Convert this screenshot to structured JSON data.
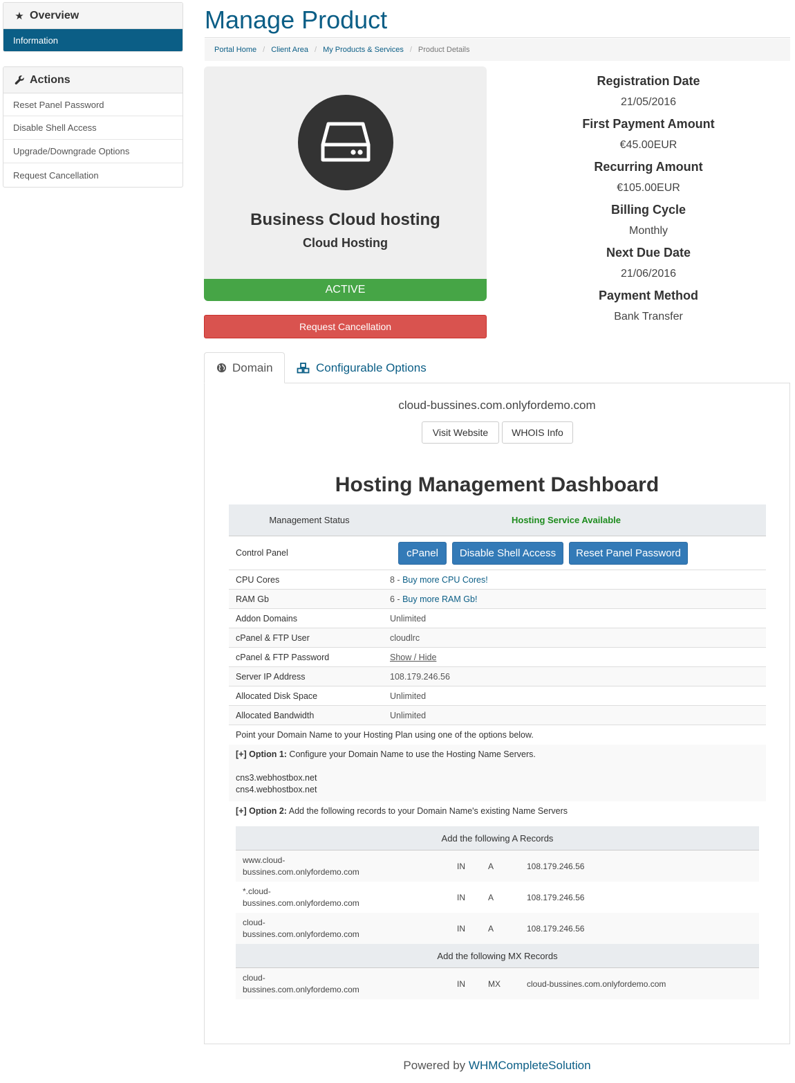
{
  "sidebar": {
    "overview": {
      "title": "Overview",
      "items": [
        "Information"
      ]
    },
    "actions": {
      "title": "Actions",
      "items": [
        "Reset Panel Password",
        "Disable Shell Access",
        "Upgrade/Downgrade Options",
        "Request Cancellation"
      ]
    }
  },
  "page": {
    "title": "Manage Product"
  },
  "breadcrumb": [
    "Portal Home",
    "Client Area",
    "My Products & Services",
    "Product Details"
  ],
  "product": {
    "name": "Business Cloud hosting",
    "group": "Cloud Hosting",
    "status": "ACTIVE",
    "cancel_label": "Request Cancellation"
  },
  "info": [
    {
      "label": "Registration Date",
      "value": "21/05/2016"
    },
    {
      "label": "First Payment Amount",
      "value": "€45.00EUR"
    },
    {
      "label": "Recurring Amount",
      "value": "€105.00EUR"
    },
    {
      "label": "Billing Cycle",
      "value": "Monthly"
    },
    {
      "label": "Next Due Date",
      "value": "21/06/2016"
    },
    {
      "label": "Payment Method",
      "value": "Bank Transfer"
    }
  ],
  "tabs": {
    "domain": "Domain",
    "config": "Configurable Options"
  },
  "domain": {
    "name": "cloud-bussines.com.onlyfordemo.com",
    "visit": "Visit Website",
    "whois": "WHOIS Info"
  },
  "dashboard": {
    "title": "Hosting Management Dashboard",
    "status_label": "Management Status",
    "status_value": "Hosting Service Available",
    "control_label": "Control Panel",
    "buttons": [
      "cPanel",
      "Disable Shell Access",
      "Reset Panel Password"
    ],
    "rows": [
      {
        "k": "CPU Cores",
        "v": "8 - ",
        "link": "Buy more CPU Cores!"
      },
      {
        "k": "RAM Gb",
        "v": "6 - ",
        "link": "Buy more RAM Gb!"
      },
      {
        "k": "Addon Domains",
        "v": "Unlimited"
      },
      {
        "k": "cPanel & FTP User",
        "v": "cloudlrc"
      },
      {
        "k": "cPanel & FTP Password",
        "v": "Show / Hide"
      },
      {
        "k": "Server IP Address",
        "v": "108.179.246.56"
      },
      {
        "k": "Allocated Disk Space",
        "v": "Unlimited"
      },
      {
        "k": "Allocated Bandwidth",
        "v": "Unlimited"
      }
    ],
    "point_note": "Point your Domain Name to your Hosting Plan using one of the options below.",
    "opt1_prefix": "[+] Option 1:",
    "opt1_text": " Configure your Domain Name to use the Hosting Name Servers.",
    "ns": [
      "cns3.webhostbox.net",
      "cns4.webhostbox.net"
    ],
    "opt2_prefix": "[+] Option 2:",
    "opt2_text": " Add the following records to your Domain Name's existing Name Servers",
    "a_title": "Add the following A Records",
    "a_records": [
      {
        "h1": "www.cloud-",
        "h2": "bussines.com.onlyfordemo.com",
        "in": "IN",
        "type": "A",
        "val": "108.179.246.56"
      },
      {
        "h1": "*.cloud-",
        "h2": "bussines.com.onlyfordemo.com",
        "in": "IN",
        "type": "A",
        "val": "108.179.246.56"
      },
      {
        "h1": "cloud-",
        "h2": "bussines.com.onlyfordemo.com",
        "in": "IN",
        "type": "A",
        "val": "108.179.246.56"
      }
    ],
    "mx_title": "Add the following MX Records",
    "mx_records": [
      {
        "h1": "cloud-",
        "h2": "bussines.com.onlyfordemo.com",
        "in": "IN",
        "type": "MX",
        "val": "cloud-bussines.com.onlyfordemo.com"
      }
    ]
  },
  "footer": {
    "prefix": "Powered by ",
    "link": "WHMCompleteSolution"
  },
  "colors": {
    "brand": "#0b5e86",
    "active": "#46a546",
    "danger": "#d9534f",
    "primary": "#337ab7",
    "available": "#1e8c1e"
  }
}
